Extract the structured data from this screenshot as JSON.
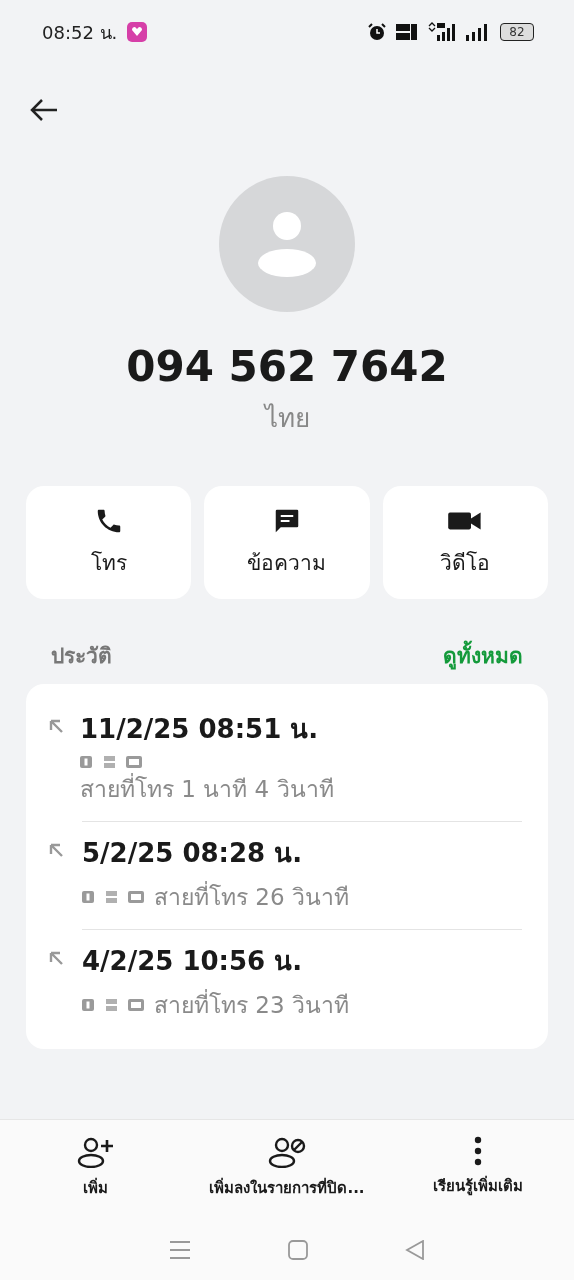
{
  "status_bar": {
    "time": "08:52 น.",
    "battery": "82"
  },
  "contact": {
    "number": "094 562 7642",
    "location": "ไทย"
  },
  "actions": [
    {
      "kind": "call",
      "label": "โทร"
    },
    {
      "kind": "message",
      "label": "ข้อความ"
    },
    {
      "kind": "video",
      "label": "วิดีโอ"
    }
  ],
  "history": {
    "title": "ประวัติ",
    "view_all": "ดูทั้งหมด",
    "calls": [
      {
        "kind": "stacked",
        "datetime": "11/2/25 08:51 น.",
        "detail": "สายที่โทร  1 นาที 4 วินาที"
      },
      {
        "kind": "inline",
        "datetime": "5/2/25 08:28 น.",
        "detail": "สายที่โทร  26 วินาที"
      },
      {
        "kind": "inline",
        "datetime": "4/2/25 10:56 น.",
        "detail": "สายที่โทร  23 วินาที"
      }
    ]
  },
  "bottom_actions": [
    {
      "kind": "add",
      "label": "เพิ่ม"
    },
    {
      "kind": "block",
      "label": "เพิ่มลงในรายการที่ปิด..."
    },
    {
      "kind": "more",
      "label": "เรียนรู้เพิ่มเติม"
    }
  ]
}
